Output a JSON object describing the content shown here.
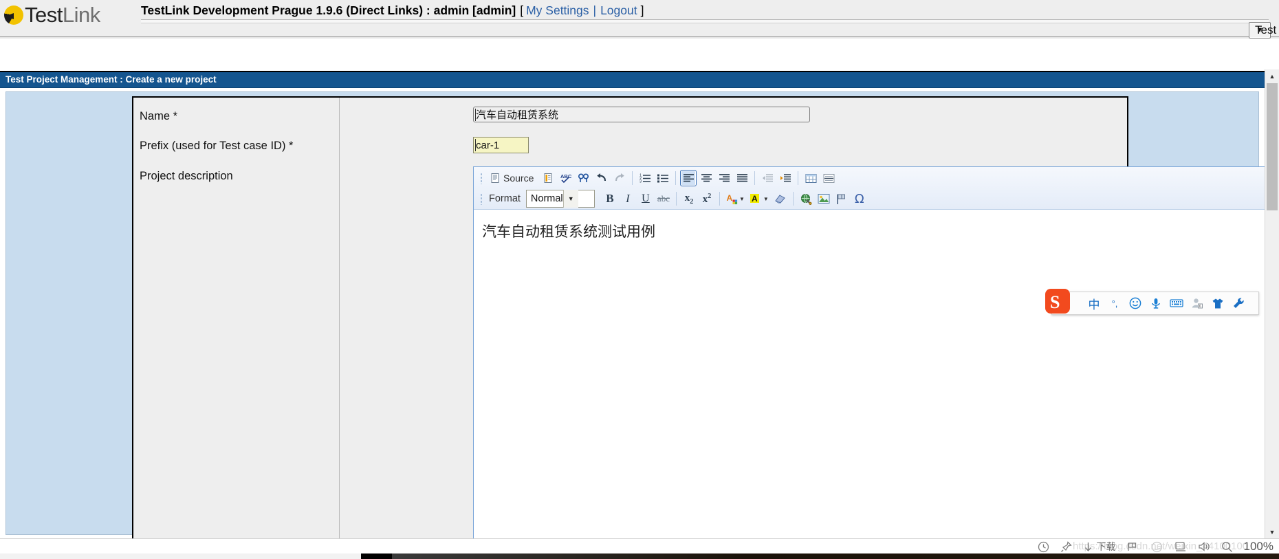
{
  "header": {
    "logo_text_bold": "Test",
    "logo_text_light": "Link",
    "logo_icon": "testlink-logo-icon",
    "title": "TestLink Development Prague 1.9.6 (Direct Links) : admin [admin]",
    "bracket_open": "[",
    "bracket_close": "]",
    "my_settings_label": "My Settings",
    "separator": "|",
    "logout_label": "Logout",
    "project_selector_label": "Test Project",
    "project_selector_arrow": "▼"
  },
  "page_title_bar": {
    "text": "Test Project Management : Create a new project",
    "background": "#14558f",
    "color": "#ffffff"
  },
  "form": {
    "fields": [
      {
        "label": "Name *",
        "value": "汽车自动租赁系统",
        "placeholder": ""
      },
      {
        "label": "Prefix (used for Test case ID) *",
        "value": "car-1",
        "placeholder": ""
      },
      {
        "label": "Project description",
        "value": "",
        "placeholder": ""
      }
    ]
  },
  "editor": {
    "toolbar_row1": [
      {
        "name": "source-icon",
        "label": "Source"
      },
      {
        "name": "templates-icon",
        "label": ""
      },
      {
        "name": "spellcheck-icon",
        "label": ""
      },
      {
        "name": "find-replace-icon",
        "label": ""
      },
      {
        "name": "undo-icon",
        "label": ""
      },
      {
        "name": "redo-icon",
        "label": ""
      },
      {
        "name": "numbered-list-icon",
        "label": ""
      },
      {
        "name": "bulleted-list-icon",
        "label": ""
      },
      {
        "name": "align-left-icon",
        "label": ""
      },
      {
        "name": "align-center-icon",
        "label": ""
      },
      {
        "name": "align-right-icon",
        "label": ""
      },
      {
        "name": "align-justify-icon",
        "label": ""
      },
      {
        "name": "outdent-icon",
        "label": ""
      },
      {
        "name": "indent-icon",
        "label": ""
      },
      {
        "name": "table-icon",
        "label": ""
      },
      {
        "name": "horizontal-rule-icon",
        "label": ""
      }
    ],
    "toolbar_row2": [
      {
        "name": "bold-icon",
        "label": "B"
      },
      {
        "name": "italic-icon",
        "label": "I"
      },
      {
        "name": "underline-icon",
        "label": "U"
      },
      {
        "name": "strikethrough-icon",
        "label": "abc"
      },
      {
        "name": "subscript-icon",
        "label": "x2"
      },
      {
        "name": "superscript-icon",
        "label": "x2"
      },
      {
        "name": "text-color-icon",
        "label": "A"
      },
      {
        "name": "background-color-icon",
        "label": "A"
      },
      {
        "name": "remove-format-icon",
        "label": ""
      },
      {
        "name": "insert-link-icon",
        "label": ""
      },
      {
        "name": "insert-image-icon",
        "label": ""
      },
      {
        "name": "anchor-icon",
        "label": ""
      },
      {
        "name": "special-char-icon",
        "label": "Ω"
      }
    ],
    "format_label": "Format",
    "format_value": "Normal",
    "format_arrow": "▼",
    "active_button": "align-left-icon",
    "content": "汽车自动租赁系统测试用例",
    "collapse_label": ""
  },
  "ime": {
    "name": "sogou-input-method-bar",
    "logo": "sogou-s-logo-icon",
    "items": [
      {
        "name": "chinese-mode-icon",
        "label": "中"
      },
      {
        "name": "punctuation-mode-icon",
        "label": "°,"
      },
      {
        "name": "emoji-icon",
        "label": "☺"
      },
      {
        "name": "voice-input-icon",
        "label": ""
      },
      {
        "name": "soft-keyboard-icon",
        "label": ""
      },
      {
        "name": "user-account-icon",
        "label": ""
      },
      {
        "name": "skin-icon",
        "label": ""
      },
      {
        "name": "toolbox-icon",
        "label": ""
      }
    ]
  },
  "statusbar": {
    "items": [
      {
        "name": "history-icon",
        "label": ""
      },
      {
        "name": "pin-icon",
        "label": ""
      },
      {
        "name": "download-icon",
        "label": "下载"
      },
      {
        "name": "notes-icon",
        "label": ""
      },
      {
        "name": "browser-icon",
        "label": ""
      },
      {
        "name": "screen-icon",
        "label": ""
      },
      {
        "name": "volume-icon",
        "label": ""
      },
      {
        "name": "zoom-icon",
        "label": ""
      }
    ],
    "zoom_level": "100%",
    "watermark": "https://blog.csdn.net/weixin_44100100"
  },
  "scrollbar": {
    "up_arrow": "▲",
    "down_arrow": "▼"
  },
  "colors": {
    "title_blue": "#14558f",
    "panel_blue": "#c8dcee",
    "link_blue": "#2a5fa5",
    "prefix_yellow": "#f6f5c4"
  }
}
